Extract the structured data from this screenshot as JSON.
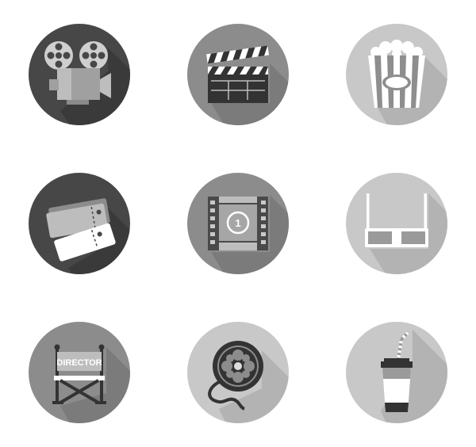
{
  "icons": [
    {
      "name": "film-projector",
      "circle_color": "#474747"
    },
    {
      "name": "clapperboard",
      "circle_color": "#8c8c8c"
    },
    {
      "name": "popcorn",
      "circle_color": "#c8c8c8"
    },
    {
      "name": "tickets",
      "circle_color": "#474747"
    },
    {
      "name": "film-countdown",
      "circle_color": "#8c8c8c"
    },
    {
      "name": "3d-glasses",
      "circle_color": "#c8c8c8"
    },
    {
      "name": "director-chair",
      "circle_color": "#8c8c8c",
      "label": "DIRECTOR"
    },
    {
      "name": "film-reel",
      "circle_color": "#c8c8c8"
    },
    {
      "name": "soda-cup",
      "circle_color": "#c8c8c8"
    }
  ],
  "countdown": {
    "number": "1"
  }
}
